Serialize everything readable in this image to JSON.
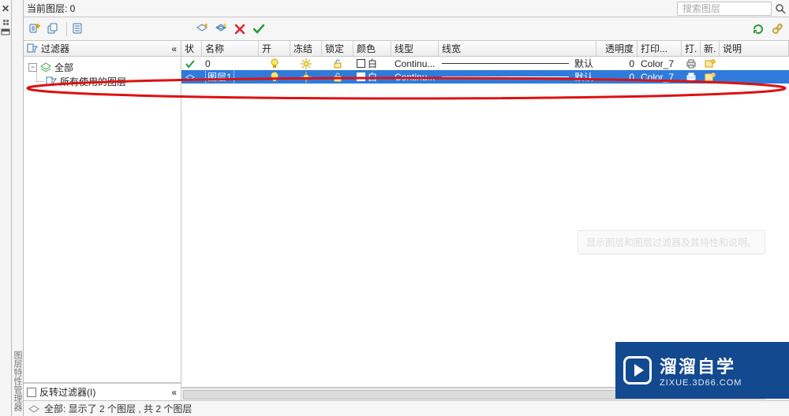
{
  "header": {
    "current_layer_label": "当前图层: 0",
    "search_placeholder": "搜索图层"
  },
  "filter": {
    "title": "过滤器",
    "tree": {
      "all": "全部",
      "used": "所有使用的图层"
    },
    "invert_label": "反转过滤器(I)"
  },
  "columns": {
    "status": "状",
    "name": "名称",
    "on": "开",
    "freeze": "冻结",
    "lock": "锁定",
    "color": "颜色",
    "linetype": "线型",
    "lineweight": "线宽",
    "transparency": "透明度",
    "plotstyle": "打印...",
    "plot": "打.",
    "new": "新.",
    "desc": "说明"
  },
  "layers": [
    {
      "name": "0",
      "current": true,
      "color_name": "白",
      "linetype": "Continu...",
      "lineweight": "默认",
      "transparency": "0",
      "plotstyle": "Color_7"
    },
    {
      "name": "图层1",
      "current": false,
      "color_name": "白",
      "linetype": "Continu...",
      "lineweight": "默认",
      "transparency": "0",
      "plotstyle": "Color_7"
    }
  ],
  "tooltip_ghost": "显示图层和图层过滤器及其特性和说明。",
  "status_bar": "全部: 显示了 2 个图层 , 共 2 个图层",
  "watermark": {
    "title": "溜溜自学",
    "url": "ZIXUE.3D66.COM"
  },
  "dockbar_text": "图层特性管理器"
}
